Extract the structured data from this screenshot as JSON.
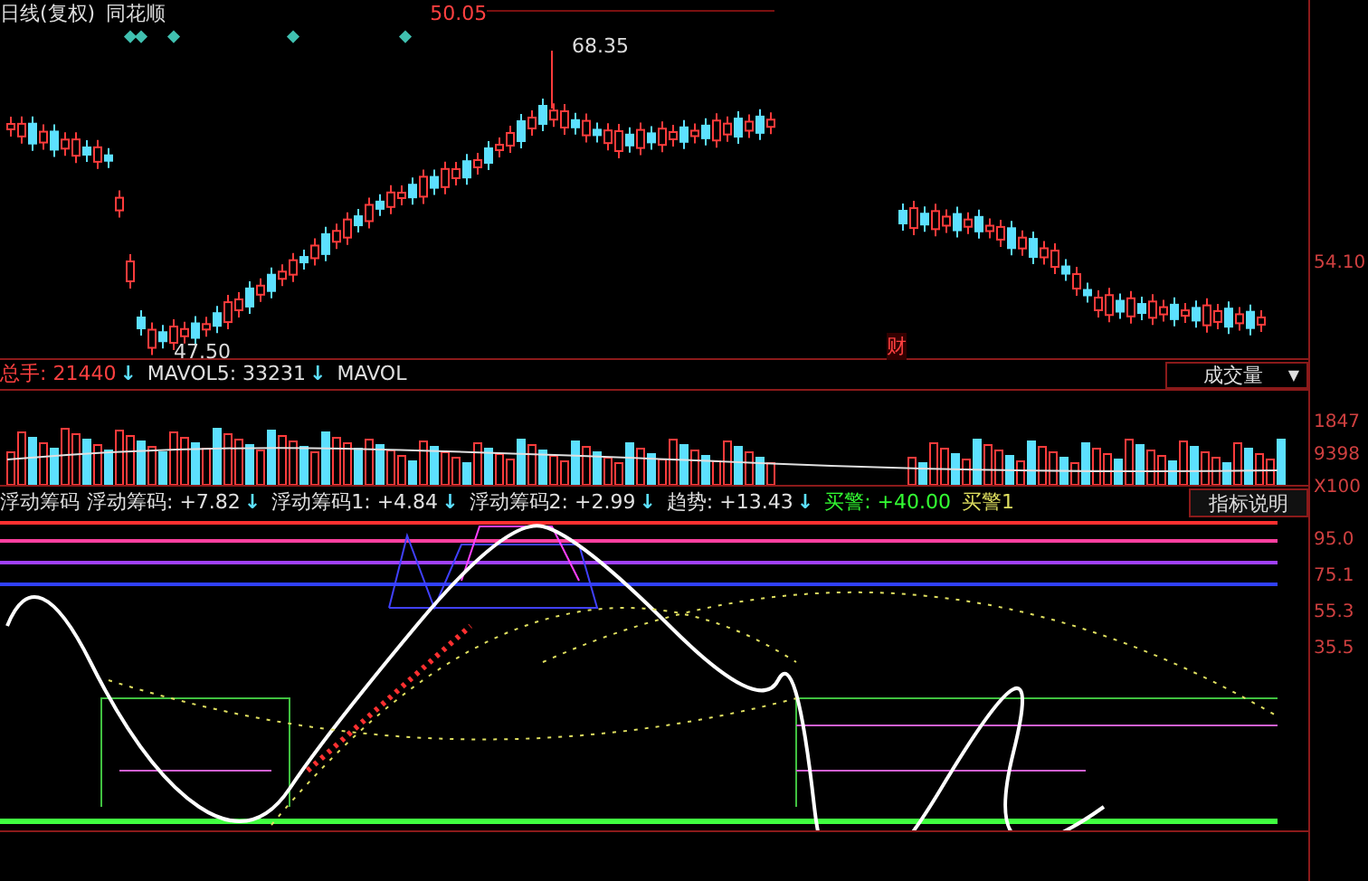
{
  "header": {
    "period": "日线(复权)",
    "app": "同花顺",
    "price": "50.05"
  },
  "price_chart": {
    "high_label": "68.35",
    "low_label": "47.50",
    "axis_labels": [
      "54.10"
    ],
    "marker": "财"
  },
  "volume": {
    "readings": [
      {
        "kind": "total",
        "label": "总手: 21440",
        "arrow": "↓"
      },
      {
        "kind": "ma",
        "label": "MAVOL5: 33231",
        "arrow": "↓"
      },
      {
        "kind": "ma",
        "label": "MAVOL"
      }
    ],
    "dropdown": "成交量",
    "dropdown_arrow": "▼",
    "axis_labels": [
      "1847",
      "9398",
      "X100"
    ]
  },
  "indicator": {
    "name": "浮动筹码",
    "readings": [
      {
        "kind": "ma",
        "label": "浮动筹码: +7.82",
        "arrow": "↓"
      },
      {
        "kind": "ma",
        "label": "浮动筹码1: +4.84",
        "arrow": "↓"
      },
      {
        "kind": "ma",
        "label": "浮动筹码2: +2.99",
        "arrow": "↓"
      },
      {
        "kind": "ma",
        "label": "趋势: +13.43",
        "arrow": "↓"
      },
      {
        "kind": "buy",
        "label": "买警: +40.00"
      },
      {
        "kind": "alert",
        "label": "买警1"
      }
    ],
    "button": "指标说明",
    "axis_labels": [
      "95.0",
      "75.1",
      "55.3",
      "35.5"
    ]
  }
}
